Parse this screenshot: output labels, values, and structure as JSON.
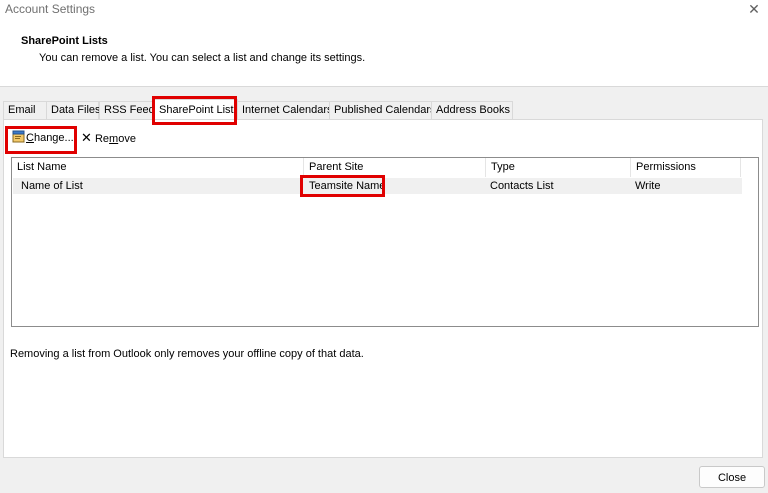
{
  "window": {
    "title": "Account Settings"
  },
  "header": {
    "title": "SharePoint Lists",
    "subtitle": "You can remove a list. You can select a list and change its settings."
  },
  "tabs": [
    {
      "label": "Email"
    },
    {
      "label": "Data Files"
    },
    {
      "label": "RSS Feeds"
    },
    {
      "label": "SharePoint Lists",
      "active": true
    },
    {
      "label": "Internet Calendars"
    },
    {
      "label": "Published Calendars"
    },
    {
      "label": "Address Books"
    }
  ],
  "toolbar": {
    "change_label_underlined": "C",
    "change_label_rest": "hange...",
    "remove_label_pre": "Re",
    "remove_label_underlined": "m",
    "remove_label_post": "ove"
  },
  "table": {
    "columns": [
      "List Name",
      "Parent Site",
      "Type",
      "Permissions"
    ],
    "rows": [
      {
        "list_name": "Name of List",
        "parent_site": "Teamsite Name",
        "type": "Contacts List",
        "permissions": "Write"
      }
    ]
  },
  "footnote": "Removing a list from Outlook only removes your offline copy of that data.",
  "buttons": {
    "close": "Close"
  },
  "colors": {
    "highlight": "#e00000"
  }
}
